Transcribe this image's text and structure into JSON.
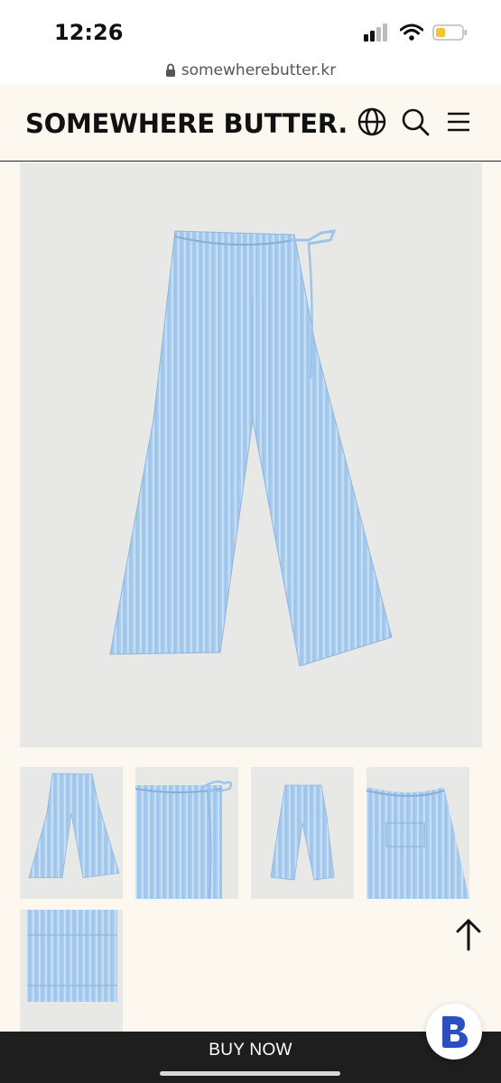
{
  "status_bar": {
    "time": "12:26"
  },
  "browser": {
    "url": "somewherebutter.kr"
  },
  "header": {
    "logo": "SOMEWHERE BUTTER."
  },
  "icons": {
    "lock": "lock-icon",
    "globe": "globe-icon",
    "search": "search-icon",
    "menu": "menu-icon",
    "scroll_top": "arrow-up-icon",
    "chat": "chat-b-icon"
  },
  "colors": {
    "header_bg": "#fcf8ef",
    "image_bg": "#e8e8e6",
    "product_blue": "#a9cdee",
    "bottom_bar": "#1e1e1e",
    "chat_brand": "#2b4ec2"
  },
  "thumbnails": [
    "front",
    "waist-detail",
    "front-small",
    "back-detail",
    "hem-detail"
  ],
  "cta": {
    "buy_label": "BUY NOW"
  }
}
